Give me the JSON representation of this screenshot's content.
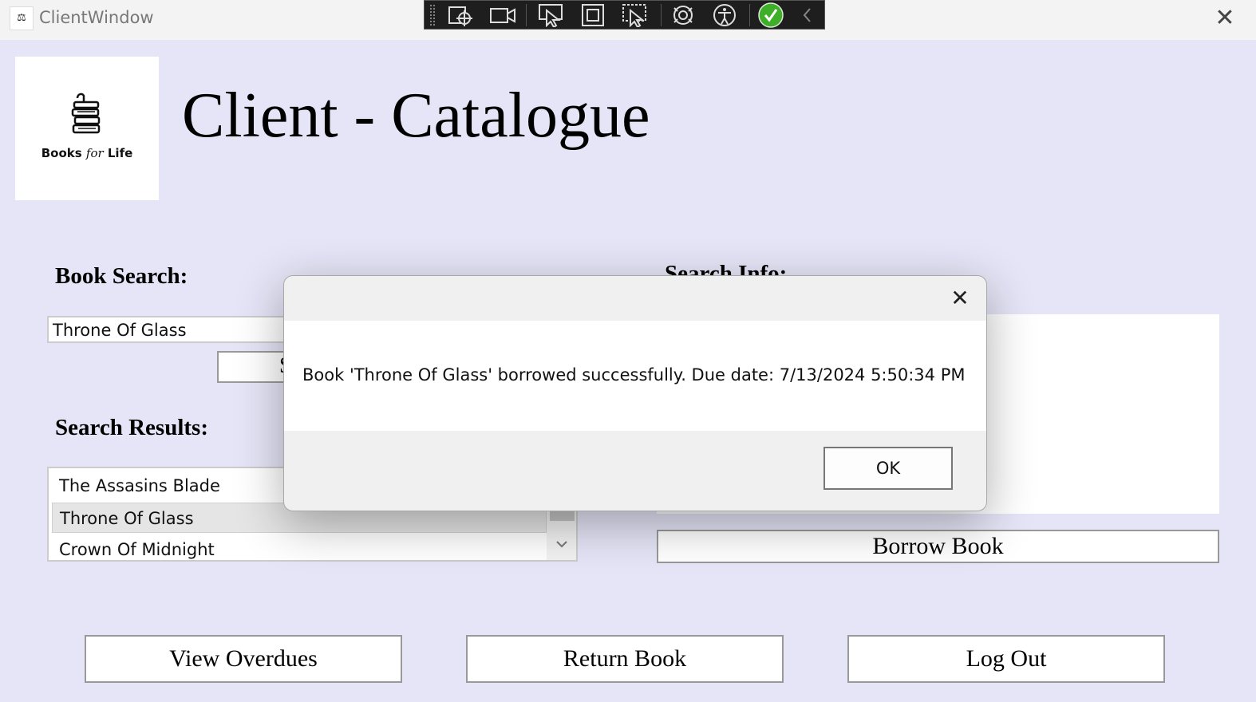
{
  "window": {
    "title": "ClientWindow",
    "app_icon_glyph": "⚖",
    "close_glyph": "✕"
  },
  "debug_toolbar": {
    "icons": [
      "grip-icon",
      "select-element-icon",
      "video-icon",
      "pointer-icon",
      "frame-icon",
      "select-cursor-icon",
      "hot-reload-icon",
      "accessibility-icon",
      "checkmark-icon",
      "collapse-icon"
    ]
  },
  "logo": {
    "text_books": "Books ",
    "text_for": "for",
    "text_life": " Life"
  },
  "page": {
    "title": "Client - Catalogue"
  },
  "search": {
    "label": "Book Search:",
    "value": "Throne Of Glass",
    "button_visible": "S"
  },
  "results": {
    "label": "Search Results:",
    "items": [
      "The Assasins Blade",
      "Throne Of Glass",
      "Crown Of Midnight"
    ],
    "selected_index": 1
  },
  "info": {
    "label_partial": "Search Info:"
  },
  "buttons": {
    "borrow": "Borrow Book",
    "view_overdues": "View Overdues",
    "return_book": "Return Book",
    "log_out": "Log Out"
  },
  "dialog": {
    "message": "Book 'Throne Of Glass' borrowed successfully. Due date: 7/13/2024 5:50:34 PM",
    "ok": "OK",
    "close_glyph": "✕"
  },
  "colors": {
    "background": "#e5e5f7",
    "accent_green": "#3fae29"
  }
}
